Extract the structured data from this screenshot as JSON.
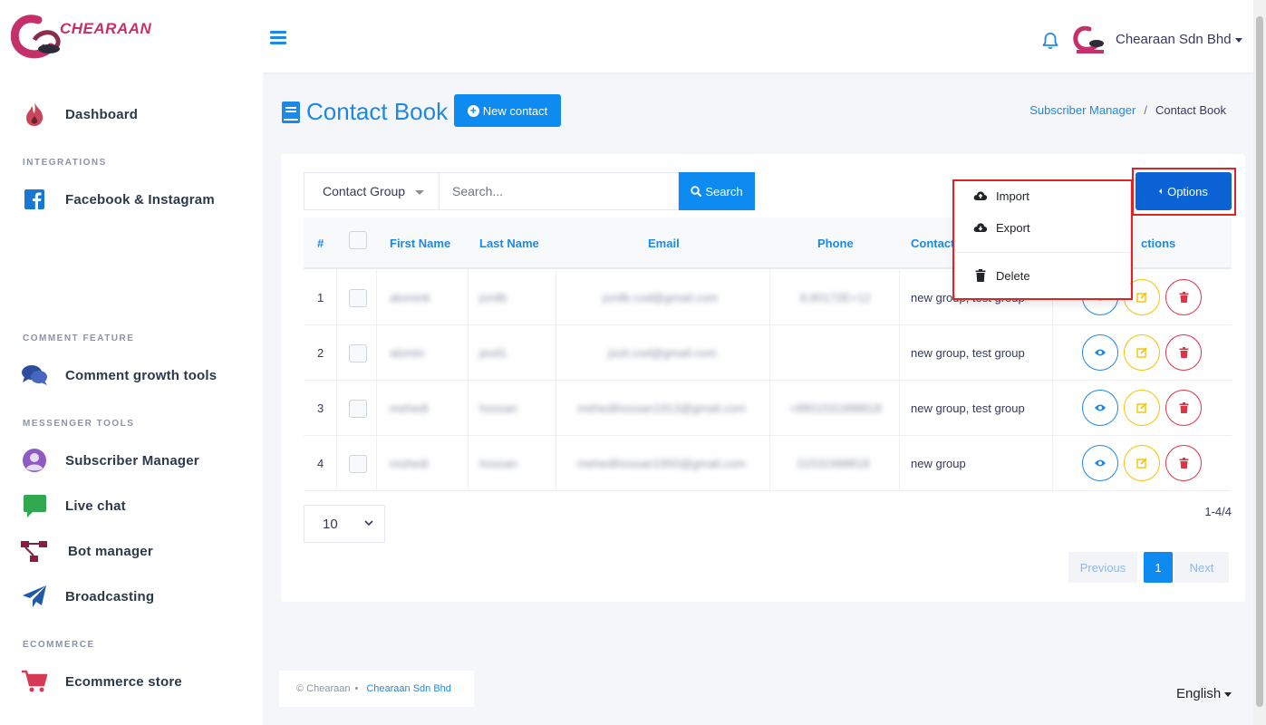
{
  "brand": {
    "name": "CHEARAAN"
  },
  "topbar": {
    "user_name": "Chearaan Sdn Bhd"
  },
  "sidebar": {
    "dashboard": "Dashboard",
    "section_integrations": "INTEGRATIONS",
    "facebook": "Facebook & Instagram",
    "section_comment": "COMMENT FEATURE",
    "comment_tools": "Comment growth tools",
    "section_messenger": "MESSENGER TOOLS",
    "subscriber_manager": "Subscriber Manager",
    "live_chat": "Live chat",
    "bot_manager": "Bot manager",
    "broadcasting": "Broadcasting",
    "section_ecommerce": "ECOMMERCE",
    "ecommerce_store": "Ecommerce store"
  },
  "page": {
    "title": "Contact Book",
    "new_contact": "New contact",
    "breadcrumb": [
      "Subscriber Manager",
      "Contact Book"
    ]
  },
  "filter": {
    "group_select": "Contact Group",
    "search_placeholder": "Search...",
    "search_button": "Search",
    "options_button": "Options"
  },
  "table": {
    "headers": [
      "#",
      "First Name",
      "Last Name",
      "Email",
      "Phone",
      "Contact",
      "ctions"
    ],
    "rows": [
      {
        "num": "1",
        "first": "alomink",
        "last": "jonilb",
        "email": "jonilb.cod@gmail.com",
        "phone": "8.80172E+12",
        "group": "new group, test group"
      },
      {
        "num": "2",
        "first": "alomin",
        "last": "jeoil1",
        "email": "jsoil.cod@gmail.com",
        "phone": "",
        "group": "new group, test group"
      },
      {
        "num": "3",
        "first": "mehedi",
        "last": "hossan",
        "email": "mehedihossan1913@gmail.com",
        "phone": "+8801531998818",
        "group": "new group, test group"
      },
      {
        "num": "4",
        "first": "mohedi",
        "last": "hossan",
        "email": "mehedihossan1950@gmail.com",
        "phone": "01531998818",
        "group": "new group"
      }
    ]
  },
  "menu": {
    "import": "Import",
    "export": "Export",
    "delete": "Delete"
  },
  "pagination": {
    "page_size": "10",
    "count": "1-4/4",
    "previous": "Previous",
    "current": "1",
    "next": "Next"
  },
  "footer": {
    "copyright": "© Chearaan",
    "bullet": "•",
    "company": "Chearaan Sdn Bhd",
    "language": "English"
  },
  "colors": {
    "primary": "#0d8bf0",
    "options": "#0b63d6",
    "highlight": "#e02424",
    "view": "#1e88e5",
    "edit": "#f5c300",
    "delete": "#dc3545"
  }
}
